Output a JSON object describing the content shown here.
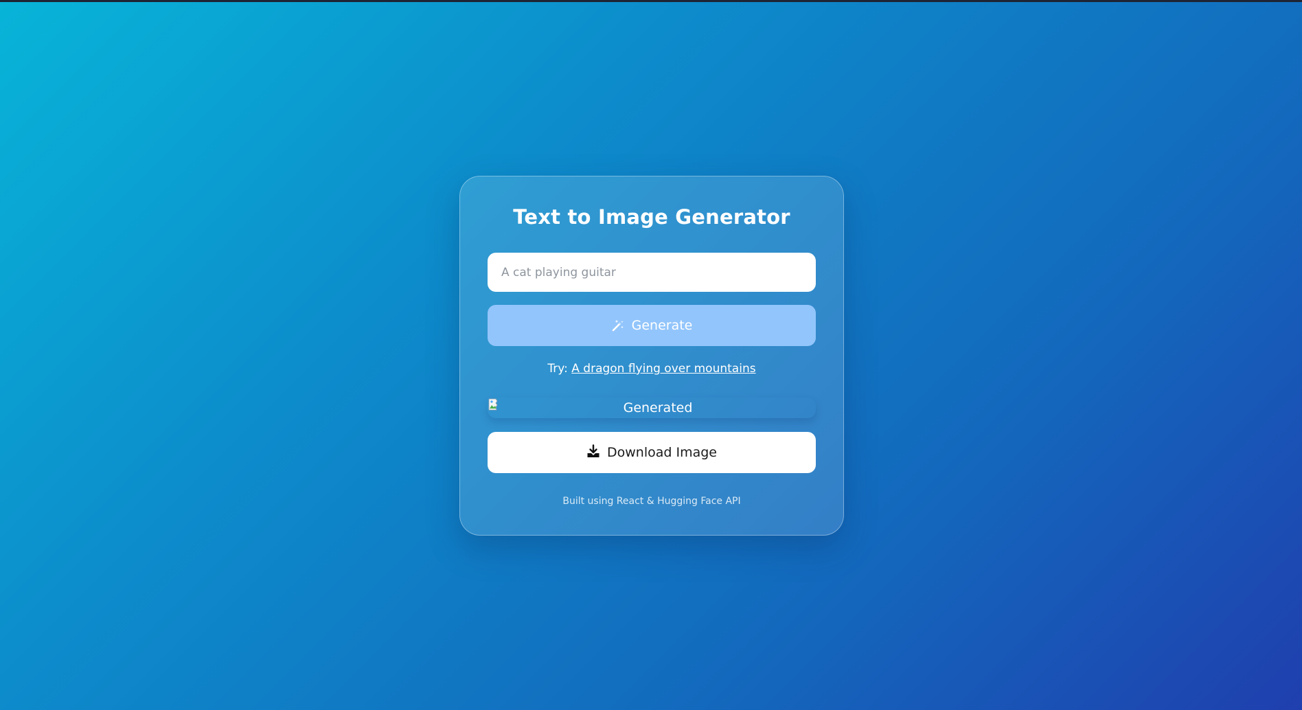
{
  "app": {
    "title": "Text to Image Generator"
  },
  "prompt": {
    "placeholder": "A cat playing guitar",
    "value": ""
  },
  "generate": {
    "label": "Generate",
    "icon": "magic-wand-icon",
    "color": "#92c5fb"
  },
  "suggestion": {
    "prefix": "Try:",
    "example": "A dragon flying over mountains"
  },
  "result": {
    "alt": "Generated",
    "icon": "broken-image-icon"
  },
  "download": {
    "label": "Download Image",
    "icon": "download-icon"
  },
  "footer": {
    "text": "Built using React & Hugging Face API"
  },
  "colors": {
    "background_start": "#08b4d8",
    "background_end": "#1f3fae",
    "card_border": "rgba(255,255,255,0.35)"
  }
}
